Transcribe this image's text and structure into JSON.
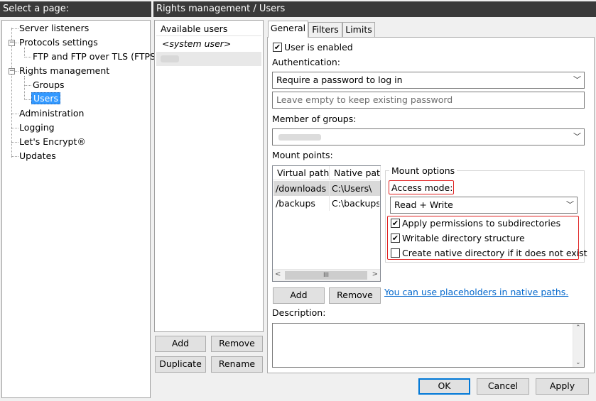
{
  "left_header": "Select a page:",
  "right_header": "Rights management / Users",
  "tree": {
    "server_listeners": "Server listeners",
    "protocols_settings": "Protocols settings",
    "ftp_tls": "FTP and FTP over TLS (FTPS)",
    "rights_management": "Rights management",
    "groups": "Groups",
    "users": "Users",
    "administration": "Administration",
    "logging": "Logging",
    "lets_encrypt": "Let's Encrypt®",
    "updates": "Updates"
  },
  "users_list": {
    "header": "Available users",
    "items": [
      "<system user>"
    ],
    "add": "Add",
    "remove": "Remove",
    "duplicate": "Duplicate",
    "rename": "Rename"
  },
  "tabs": [
    "General",
    "Filters",
    "Limits"
  ],
  "general": {
    "user_enabled_label": "User is enabled",
    "user_enabled": true,
    "authentication_label": "Authentication:",
    "authentication_value": "Require a password to log in",
    "password_placeholder": "Leave empty to keep existing password",
    "member_of_groups_label": "Member of groups:",
    "mount_points_label": "Mount points:",
    "mount_columns": [
      "Virtual path",
      "Native path"
    ],
    "mount_rows": [
      {
        "virtual": "/downloads",
        "native": "C:\\Users\\"
      },
      {
        "virtual": "/backups",
        "native": "C:\\backups"
      }
    ],
    "mount_options_label": "Mount options",
    "access_mode_label": "Access mode:",
    "access_mode_value": "Read + Write",
    "options": [
      {
        "label": "Apply permissions to subdirectories",
        "checked": true
      },
      {
        "label": "Writable directory structure",
        "checked": true
      },
      {
        "label": "Create native directory if it does not exist",
        "checked": false
      }
    ],
    "add": "Add",
    "remove": "Remove",
    "placeholders_link": "You can use placeholders in native paths.",
    "description_label": "Description:",
    "scroll_hscroll_mark": "III"
  },
  "footer": {
    "ok": "OK",
    "cancel": "Cancel",
    "apply": "Apply"
  },
  "colors": {
    "header_bg": "#3a3a3a",
    "selection": "#3399ff",
    "highlight_box": "#e02020",
    "link": "#0066cc"
  }
}
